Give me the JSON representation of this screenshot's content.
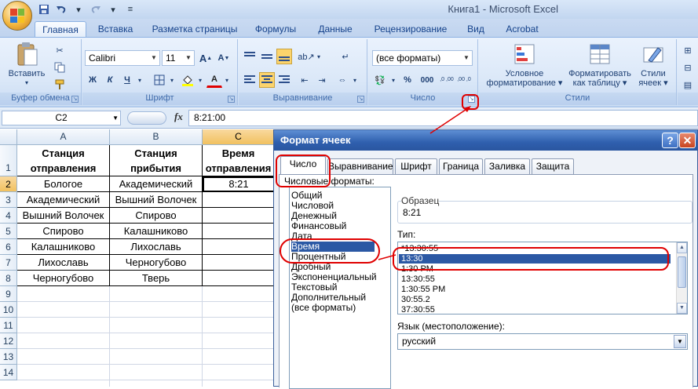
{
  "window": {
    "title": "Книга1 - Microsoft Excel"
  },
  "ribbon_tabs": [
    "Главная",
    "Вставка",
    "Разметка страницы",
    "Формулы",
    "Данные",
    "Рецензирование",
    "Вид",
    "Acrobat"
  ],
  "ribbon": {
    "clipboard": {
      "paste_label": "Вставить",
      "group_label": "Буфер обмена"
    },
    "font": {
      "font_name": "Calibri",
      "font_size": "11",
      "bold": "Ж",
      "italic": "К",
      "underline": "Ч",
      "group_label": "Шрифт"
    },
    "alignment": {
      "group_label": "Выравнивание"
    },
    "number": {
      "format_value": "(все форматы)",
      "percent": "%",
      "thousands": "000",
      "inc_dec": ",0 ,00",
      "dec_dec": ",00 ,0",
      "group_label": "Число"
    },
    "styles": {
      "conditional": "Условное форматирование",
      "as_table": "Форматировать как таблицу",
      "cell_styles": "Стили ячеек",
      "group_label": "Стили"
    }
  },
  "formula_bar": {
    "name_box": "C2",
    "fx": "fx",
    "value": "8:21:00"
  },
  "sheet": {
    "columns": [
      "A",
      "B",
      "C"
    ],
    "rows": [
      "1",
      "2",
      "3",
      "4",
      "5",
      "6",
      "7",
      "8",
      "9",
      "10",
      "11",
      "12",
      "13",
      "14"
    ],
    "header": [
      "Станция отправления",
      "Станция прибытия",
      "Время отправления"
    ],
    "data": [
      [
        "Бологое",
        "Академический",
        "8:21"
      ],
      [
        "Академический",
        "Вышний Волочек",
        ""
      ],
      [
        "Вышний Волочек",
        "Спирово",
        ""
      ],
      [
        "Спирово",
        "Калашниково",
        ""
      ],
      [
        "Калашниково",
        "Лихославь",
        ""
      ],
      [
        "Лихославь",
        "Черногубово",
        ""
      ],
      [
        "Черногубово",
        "Тверь",
        ""
      ]
    ]
  },
  "dialog": {
    "title": "Формат ячеек",
    "help": "?",
    "close": "✕",
    "tabs": [
      "Число",
      "Выравнивание",
      "Шрифт",
      "Граница",
      "Заливка",
      "Защита"
    ],
    "formats_label": "Числовые форматы:",
    "categories": [
      "Общий",
      "Числовой",
      "Денежный",
      "Финансовый",
      "Дата",
      "Время",
      "Процентный",
      "Дробный",
      "Экспоненциальный",
      "Текстовый",
      "Дополнительный",
      "(все форматы)"
    ],
    "selected_category": "Время",
    "sample_label": "Образец",
    "sample_value": "8:21",
    "type_label": "Тип:",
    "types": [
      "*13:30:55",
      "13:30",
      "1:30 PM",
      "13:30:55",
      "1:30:55 PM",
      "30:55.2",
      "37:30:55"
    ],
    "selected_type": "13:30",
    "lang_label": "Язык (местоположение):",
    "lang_value": "русский"
  },
  "colors": {
    "selection": "#2b58a4",
    "annotation": "#e00000",
    "ribbon_text": "#15428b"
  }
}
